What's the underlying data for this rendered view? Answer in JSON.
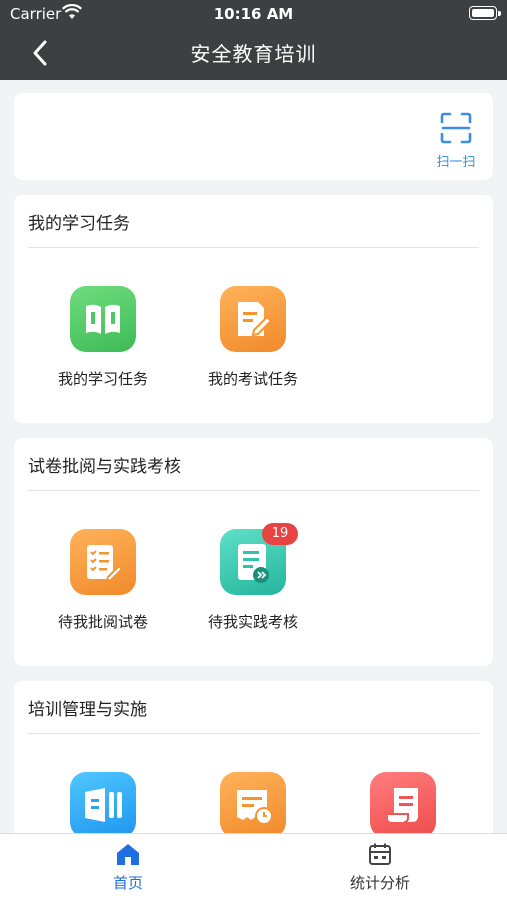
{
  "status": {
    "carrier": "Carrier",
    "time": "10:16 AM"
  },
  "nav": {
    "title": "安全教育培训"
  },
  "scan": {
    "label": "扫一扫"
  },
  "sections": [
    {
      "title": "我的学习任务",
      "items": [
        {
          "label": "我的学习任务",
          "icon": "book-icon",
          "color": "#4cc963"
        },
        {
          "label": "我的考试任务",
          "icon": "exam-edit-icon",
          "color": "#f5952f"
        }
      ]
    },
    {
      "title": "试卷批阅与实践考核",
      "items": [
        {
          "label": "待我批阅试卷",
          "icon": "review-paper-icon",
          "color": "#f5952f"
        },
        {
          "label": "待我实践考核",
          "icon": "practice-check-icon",
          "color": "#2ec4aa",
          "badge": "19"
        }
      ]
    },
    {
      "title": "培训管理与实施",
      "items": [
        {
          "icon": "training-plan-icon",
          "color": "#2aa3f5"
        },
        {
          "icon": "training-schedule-icon",
          "color": "#f5952f"
        },
        {
          "icon": "training-record-icon",
          "color": "#f25555"
        }
      ]
    }
  ],
  "tabbar": {
    "active_color": "#1f6fe0",
    "items": [
      {
        "label": "首页",
        "icon": "home-icon"
      },
      {
        "label": "统计分析",
        "icon": "calendar-stats-icon"
      }
    ]
  }
}
